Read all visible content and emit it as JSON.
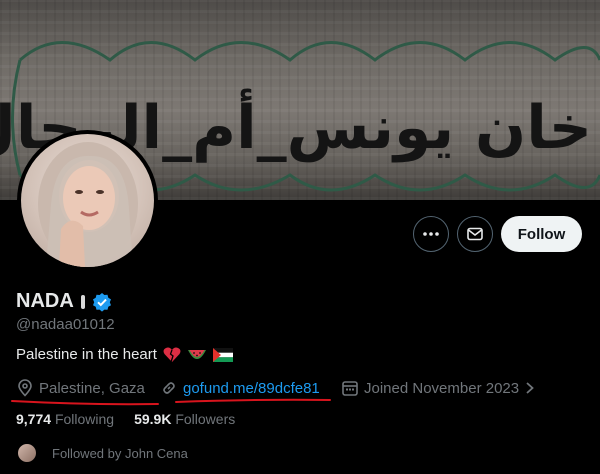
{
  "banner": {
    "graffiti_text": "خان يونس_أم_الرجال"
  },
  "profile": {
    "name": "NADA",
    "handle": "@nadaa01012",
    "bio": "Palestine in the heart",
    "location": "Palestine, Gaza",
    "link": "gofund.me/89dcfe81",
    "joined": "Joined November 2023"
  },
  "actions": {
    "follow_label": "Follow"
  },
  "stats": {
    "following_count": "9,774",
    "following_label": "Following",
    "followers_count": "59.9K",
    "followers_label": "Followers"
  },
  "followed_by": "Followed by John Cena",
  "colors": {
    "accent": "#1d9bf0",
    "annotation": "#d8141d",
    "background": "#000000"
  }
}
